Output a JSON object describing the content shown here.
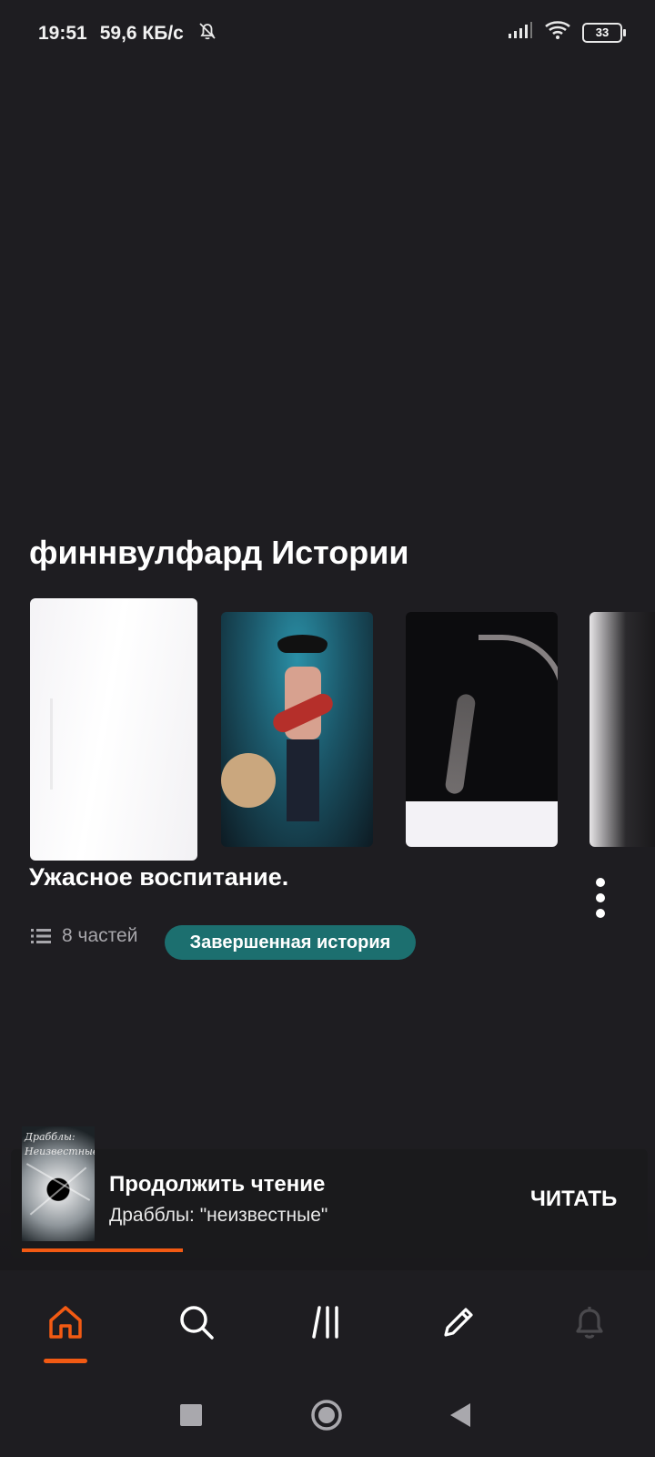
{
  "status_bar": {
    "time": "19:51",
    "speed": "59,6 КБ/с",
    "battery": "33"
  },
  "section": {
    "title": "финнвулфард Истории"
  },
  "story": {
    "title": "Ужасное воспитание.",
    "parts": "8 частей",
    "status": "Завершенная история"
  },
  "continue_reading": {
    "title": "Продолжить чтение",
    "book": "Драбблы: \"неизвестные\"",
    "button": "ЧИТАТЬ",
    "cover_caption_1": "Драбблы:",
    "cover_caption_2": "Неизвестные",
    "progress": 0.26
  },
  "colors": {
    "accent": "#f25a13",
    "badge": "#1c6f6f",
    "background": "#1e1d21"
  },
  "nav": {
    "items": [
      "home-icon",
      "search-icon",
      "library-icon",
      "write-icon",
      "bell-icon"
    ],
    "active": "home-icon"
  }
}
